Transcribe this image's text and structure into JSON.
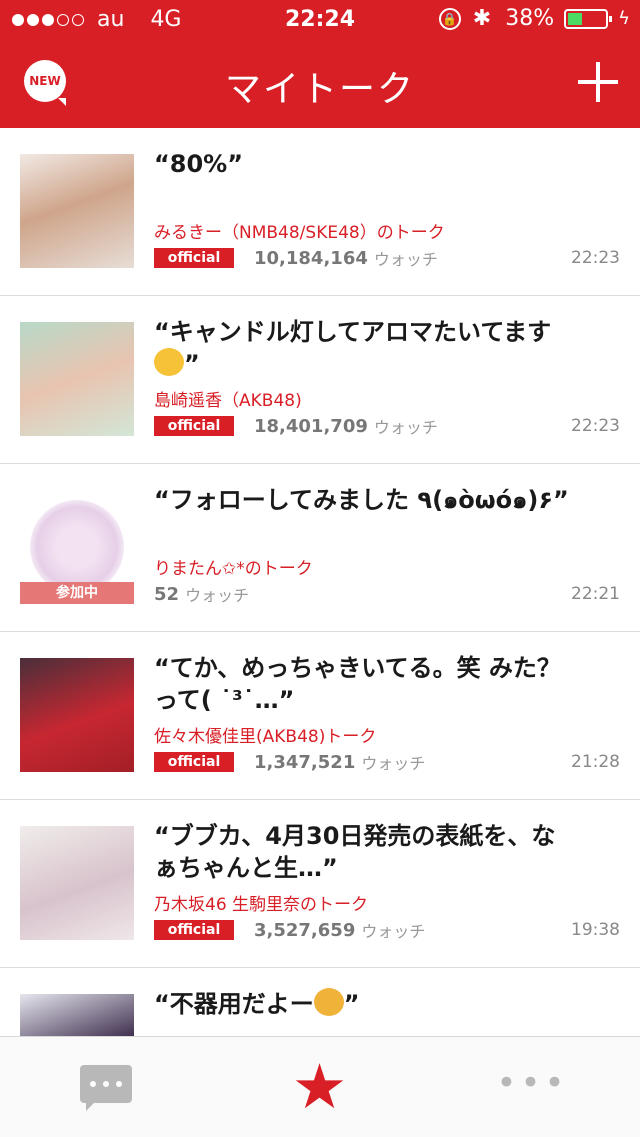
{
  "status_bar": {
    "carrier": "au",
    "network": "4G",
    "time": "22:24",
    "battery_text": "38%",
    "battery_level": 0.38
  },
  "header": {
    "new_label": "NEW",
    "title": "マイトーク"
  },
  "talks": [
    {
      "message": "“80%”",
      "room": "みるきー（NMB48/SKE48）のトーク",
      "badge": "official",
      "count": "10,184,164",
      "watch_label": "ウォッチ",
      "time": "22:23"
    },
    {
      "message": "“キャンドル灯してアロマたいてます",
      "message_tail": "”",
      "room": "島崎遥香（AKB48)",
      "badge": "official",
      "count": "18,401,709",
      "watch_label": "ウォッチ",
      "time": "22:23"
    },
    {
      "message": "“フォローしてみました ٩(๑òωó๑)۶”",
      "room": "りまたん✩*のトーク",
      "joined_label": "参加中",
      "count": "52",
      "watch_label": "ウォッチ",
      "time": "22:21"
    },
    {
      "message": "“てか、めっちゃきいてる。笑 みた？って( ˙³˙…”",
      "room": "佐々木優佳里(AKB48)トーク",
      "badge": "official",
      "count": "1,347,521",
      "watch_label": "ウォッチ",
      "time": "21:28"
    },
    {
      "message": "“ブブカ、4月30日発売の表紙を、なぁちゃんと生…”",
      "room": "乃木坂46 生駒里奈のトーク",
      "badge": "official",
      "count": "3,527,659",
      "watch_label": "ウォッチ",
      "time": "19:38"
    },
    {
      "message": "“不器用だよー",
      "message_tail": "”"
    }
  ],
  "tabbar": {
    "star_glyph": "★",
    "more_glyph": "•••"
  },
  "colors": {
    "brand_red": "#d81f26",
    "joined_pink": "#e57777"
  }
}
